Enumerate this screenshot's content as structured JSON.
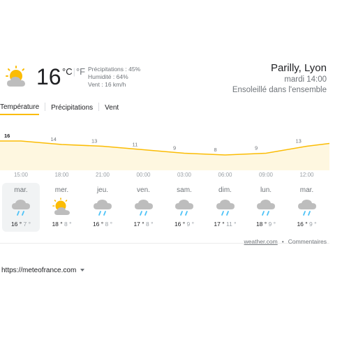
{
  "current": {
    "temp": "16",
    "unit_c": "°C",
    "unit_f": "°F",
    "precip": "Précipitations : 45%",
    "humidity": "Humidité : 64%",
    "wind": "Vent : 16 km/h",
    "icon": "partly-sunny-icon"
  },
  "location": {
    "city": "Parilly, Lyon",
    "time": "mardi 14:00",
    "condition": "Ensoleillé dans l'ensemble"
  },
  "tabs": [
    {
      "label": "Température",
      "active": true
    },
    {
      "label": "Précipitations",
      "active": false
    },
    {
      "label": "Vent",
      "active": false
    }
  ],
  "chart_data": {
    "type": "area",
    "x": [
      "15:00",
      "18:00",
      "21:00",
      "00:00",
      "03:00",
      "06:00",
      "09:00",
      "12:00"
    ],
    "values": [
      16,
      14,
      13,
      11,
      9,
      8,
      9,
      13
    ],
    "labels": [
      "16",
      "14",
      "13",
      "11",
      "9",
      "8",
      "9",
      "13"
    ],
    "color": "#fbbc04",
    "fill": "#fef7e0"
  },
  "days": [
    {
      "name": "mar.",
      "hi": "16 °",
      "lo": "7 °",
      "icon": "rain-cloud-icon",
      "selected": true
    },
    {
      "name": "mer.",
      "hi": "18 °",
      "lo": "8 °",
      "icon": "partly-sunny-icon",
      "selected": false
    },
    {
      "name": "jeu.",
      "hi": "16 °",
      "lo": "8 °",
      "icon": "rain-cloud-icon",
      "selected": false
    },
    {
      "name": "ven.",
      "hi": "17 °",
      "lo": "8 °",
      "icon": "rain-cloud-icon",
      "selected": false
    },
    {
      "name": "sam.",
      "hi": "16 °",
      "lo": "9 °",
      "icon": "rain-cloud-icon",
      "selected": false
    },
    {
      "name": "dim.",
      "hi": "17 °",
      "lo": "11 °",
      "icon": "rain-cloud-icon",
      "selected": false
    },
    {
      "name": "lun.",
      "hi": "18 °",
      "lo": "9 °",
      "icon": "rain-cloud-icon",
      "selected": false
    },
    {
      "name": "mar.",
      "hi": "16 °",
      "lo": "9 °",
      "icon": "rain-cloud-icon",
      "selected": false
    }
  ],
  "footer": {
    "source": "weather.com",
    "separator": "•",
    "feedback": "Commentaires"
  },
  "url": "https://meteofrance.com"
}
